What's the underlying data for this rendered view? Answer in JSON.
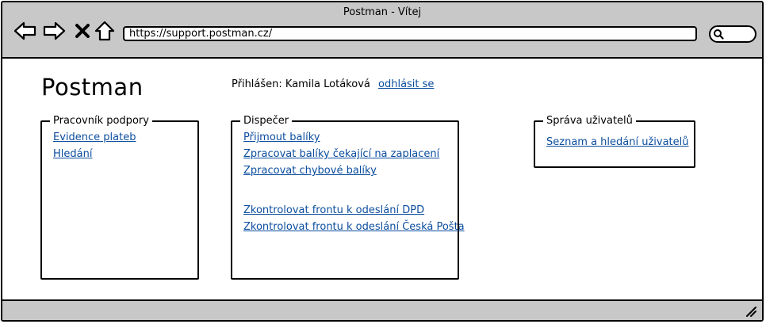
{
  "window": {
    "title": "Postman - Vítej"
  },
  "toolbar": {
    "address": "https://support.postman.cz/",
    "icons": [
      "back-icon",
      "forward-icon",
      "stop-icon",
      "home-icon",
      "search-icon"
    ]
  },
  "header": {
    "logo": "Postman",
    "logged_label": "Přihlášen: Kamila Lotáková",
    "logout_link": "odhlásit se"
  },
  "panels": {
    "support": {
      "legend": "Pracovník podpory",
      "links": [
        "Evidence plateb",
        "Hledání"
      ]
    },
    "dispatcher": {
      "legend": "Dispečer",
      "links": [
        "Přijmout balíky",
        "Zpracovat balíky čekající na zaplacení",
        "Zpracovat chybové balíky",
        "Zkontrolovat frontu k odeslání DPD",
        "Zkontrolovat frontu k odeslání Česká Pošta"
      ]
    },
    "users": {
      "legend": "Správa uživatelů",
      "links": [
        "Seznam a hledání uživatelů"
      ]
    }
  },
  "colors": {
    "chrome": "#c8c8c8",
    "link": "#0b4d9e"
  }
}
